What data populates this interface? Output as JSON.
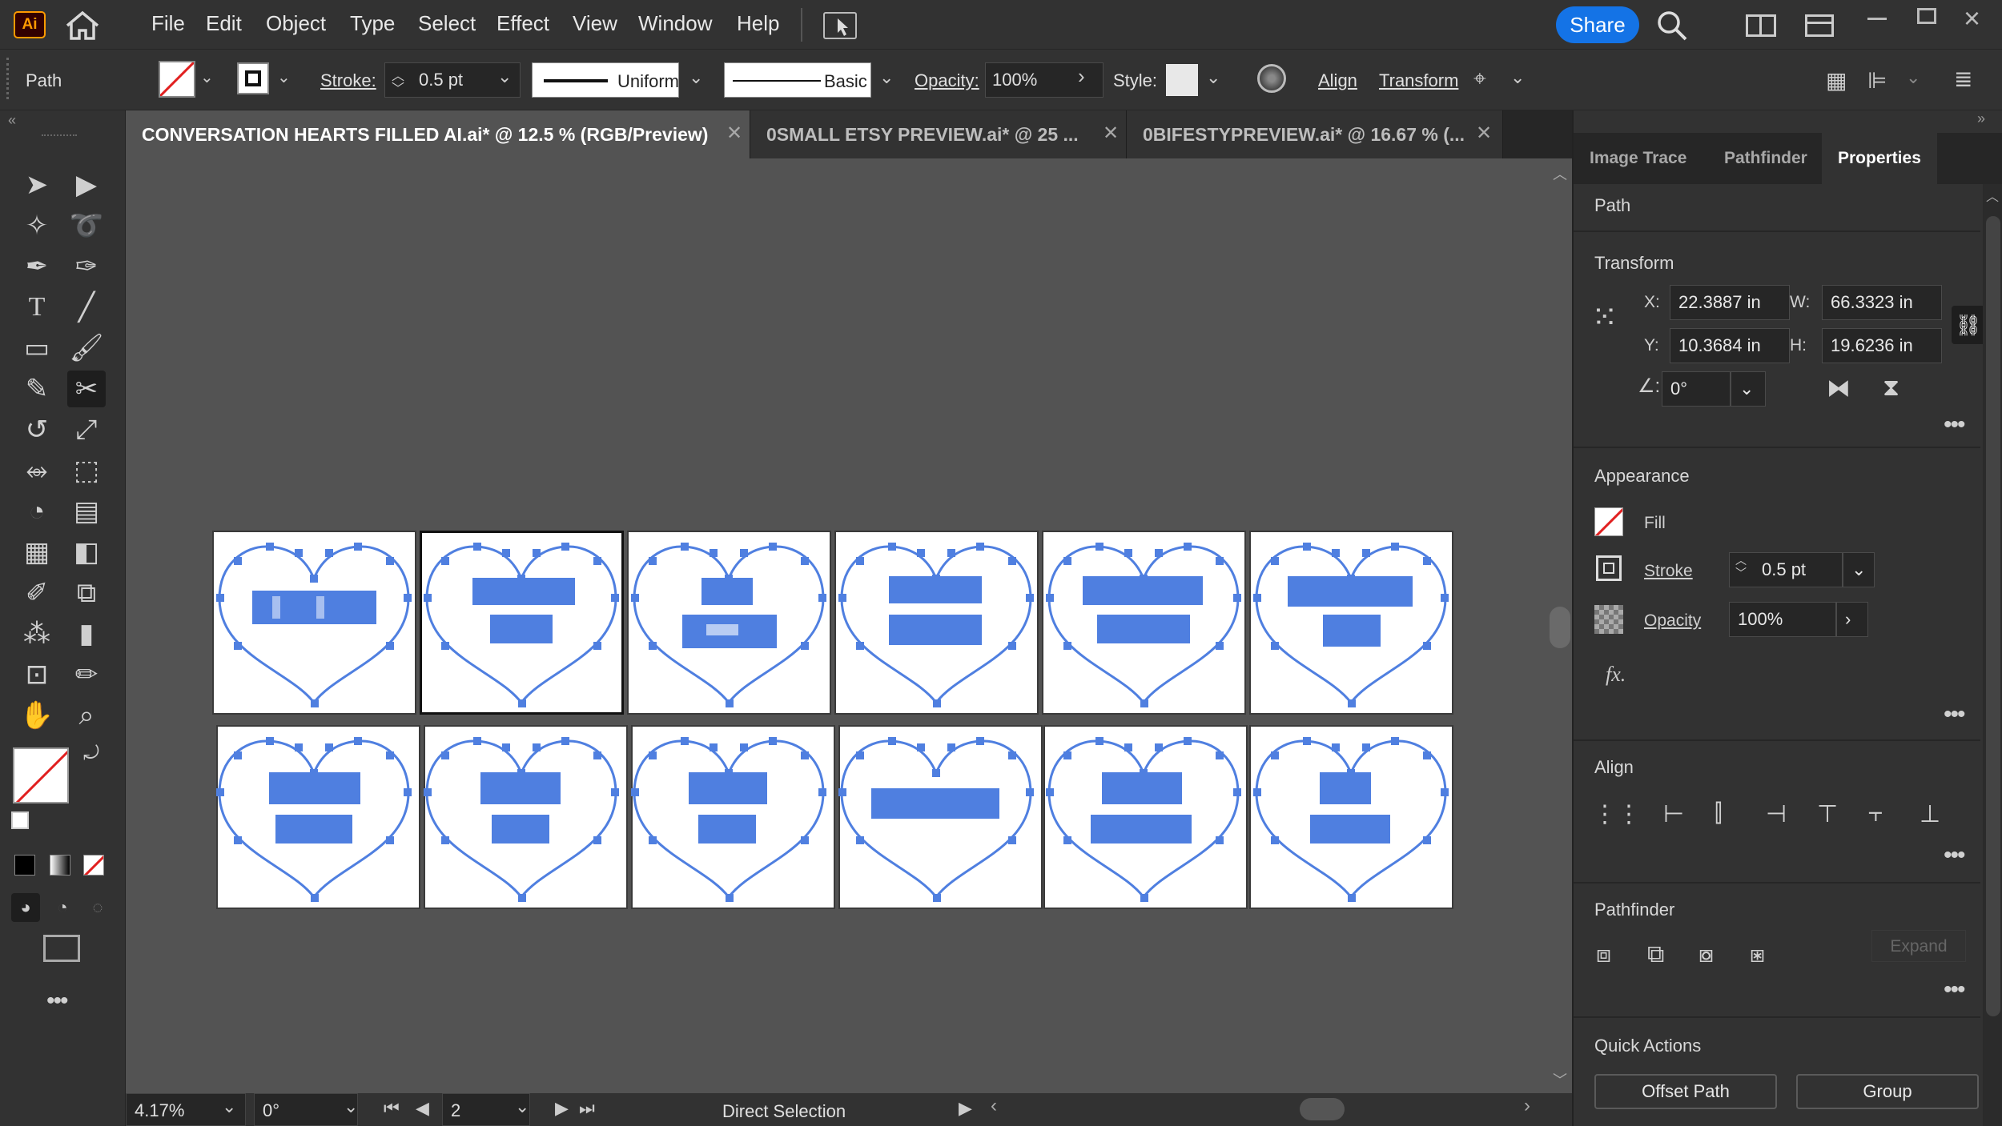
{
  "app": {
    "logo": "Ai",
    "home_icon": "home-icon"
  },
  "menu": [
    "File",
    "Edit",
    "Object",
    "Type",
    "Select",
    "Effect",
    "View",
    "Window",
    "Help"
  ],
  "topright": {
    "share": "Share"
  },
  "control": {
    "object_type": "Path",
    "stroke_label": "Stroke:",
    "stroke_value": "0.5 pt",
    "profile": "Uniform",
    "brush": "Basic",
    "opacity_label": "Opacity:",
    "opacity_value": "100%",
    "style_label": "Style:",
    "align": "Align",
    "transform": "Transform"
  },
  "tabs": [
    {
      "title": "CONVERSATION HEARTS FILLED AI.ai* @ 12.5 % (RGB/Preview)"
    },
    {
      "title": "0SMALL ETSY PREVIEW.ai* @ 25 ..."
    },
    {
      "title": "0BIFESTYPREVIEW.ai* @ 16.67 % (..."
    }
  ],
  "status": {
    "zoom": "4.17%",
    "rotation": "0°",
    "artboard": "2",
    "tool": "Direct Selection"
  },
  "panel": {
    "tabs": [
      "Image Trace",
      "Pathfinder",
      "Properties"
    ],
    "object_type": "Path",
    "transform": {
      "title": "Transform",
      "x_label": "X:",
      "x": "22.3887 in",
      "y_label": "Y:",
      "y": "10.3684 in",
      "w_label": "W:",
      "w": "66.3323 in",
      "h_label": "H:",
      "h": "19.6236 in",
      "angle": "0°"
    },
    "appearance": {
      "title": "Appearance",
      "fill": "Fill",
      "stroke": "Stroke",
      "stroke_value": "0.5 pt",
      "opacity": "Opacity",
      "opacity_value": "100%",
      "fx": "fx."
    },
    "align": {
      "title": "Align"
    },
    "pathfinder": {
      "title": "Pathfinder",
      "expand": "Expand"
    },
    "quick_actions": {
      "title": "Quick Actions",
      "offset_path": "Offset Path",
      "group": "Group"
    }
  },
  "colors": {
    "heart": "#4f7fe0",
    "accent": "#1473e6"
  }
}
